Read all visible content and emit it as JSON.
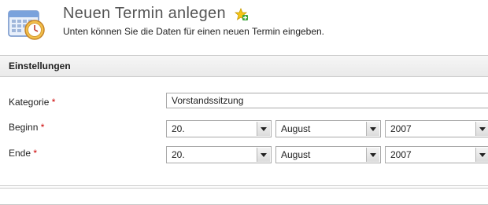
{
  "header": {
    "title": "Neuen Termin anlegen",
    "subtitle": "Unten können Sie die Daten für einen neuen Termin eingeben."
  },
  "settings": {
    "heading": "Einstellungen",
    "required_marker": "*",
    "category": {
      "label": "Kategorie",
      "value": "Vorstandssitzung"
    },
    "begin": {
      "label": "Beginn",
      "day": "20.",
      "month": "August",
      "year": "2007"
    },
    "end": {
      "label": "Ende",
      "day": "20.",
      "month": "August",
      "year": "2007"
    }
  },
  "icons": {
    "app": "calendar-clock-icon",
    "add": "star-plus-icon"
  },
  "colors": {
    "required": "#cc0000",
    "title": "#555555"
  }
}
